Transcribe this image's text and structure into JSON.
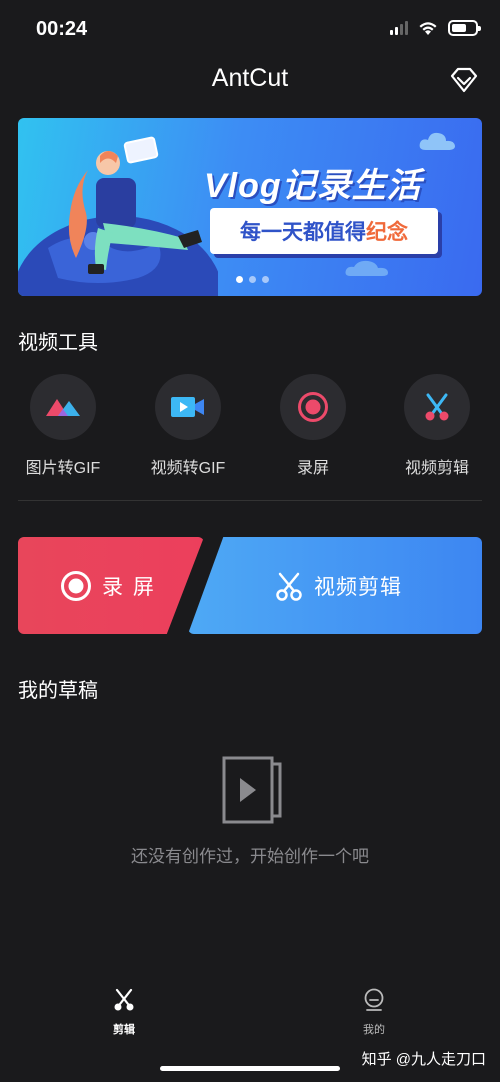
{
  "status_bar": {
    "time": "00:24"
  },
  "header": {
    "title": "AntCut",
    "vip_icon": "diamond-icon"
  },
  "banner": {
    "headline": "Vlog记录生活",
    "subline_main": "每一天都值得",
    "subline_accent": "纪念",
    "page_count": 3,
    "active_page": 1
  },
  "tools_section": {
    "title": "视频工具",
    "items": [
      {
        "label": "图片转GIF",
        "icon": "image-icon"
      },
      {
        "label": "视频转GIF",
        "icon": "video-camera-icon"
      },
      {
        "label": "录屏",
        "icon": "record-icon"
      },
      {
        "label": "视频剪辑",
        "icon": "scissors-icon"
      }
    ]
  },
  "actions": {
    "record_label": "录 屏",
    "edit_label": "视频剪辑"
  },
  "drafts": {
    "title": "我的草稿",
    "empty_text": "还没有创作过，开始创作一个吧"
  },
  "tabbar": {
    "items": [
      {
        "label": "剪辑",
        "icon": "scissors-icon",
        "active": true
      },
      {
        "label": "我的",
        "icon": "profile-icon",
        "active": false
      }
    ]
  },
  "watermark": "知乎 @九人走刀口",
  "colors": {
    "background": "#1a1a1c",
    "record_red": "#e8465b",
    "edit_blue": "#4ea9f5"
  }
}
